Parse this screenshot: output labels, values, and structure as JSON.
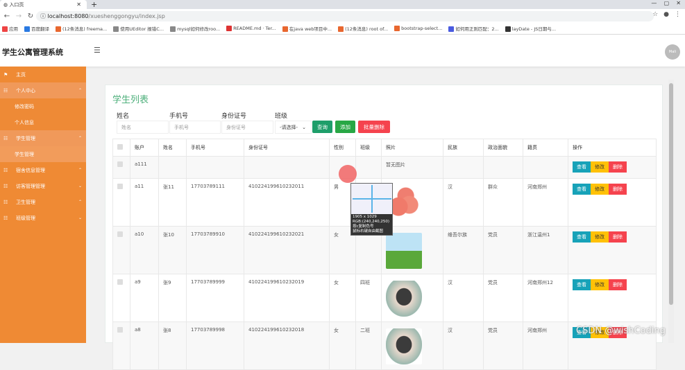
{
  "browser": {
    "tab_title": "入口页",
    "url_domain": "localhost:8080",
    "url_path": "/xueshenggongyu/index.jsp",
    "bookmarks": [
      "应用",
      "百度翻译",
      "(12条消息) freema...",
      "使用UEditor 报错C...",
      "mysql如何修改roo...",
      "README.md · Ter...",
      "在java web项目中...",
      "(12条消息) root of...",
      "bootstrap-select...",
      "如何用正则匹配：2...",
      "layDate - JS日期与..."
    ]
  },
  "header": {
    "title": "学生公寓管理系统",
    "avatar": "Mali"
  },
  "sidebar": {
    "items": [
      {
        "label": "主页",
        "icon": "flag-icon"
      },
      {
        "label": "个人中心",
        "icon": "grid-icon",
        "children": [
          "修改密码",
          "个人信息"
        ]
      },
      {
        "label": "学生管理",
        "icon": "grid-icon",
        "children": [
          "学生管理"
        ]
      },
      {
        "label": "宿舍信息管理",
        "icon": "grid-icon"
      },
      {
        "label": "访客管理管理",
        "icon": "grid-icon"
      },
      {
        "label": "卫生管理",
        "icon": "grid-icon"
      },
      {
        "label": "班级管理",
        "icon": "grid-icon"
      }
    ]
  },
  "main": {
    "title": "学生列表",
    "filters": {
      "name_label": "姓名",
      "name_placeholder": "姓名",
      "phone_label": "手机号",
      "phone_placeholder": "手机号",
      "id_label": "身份证号",
      "id_placeholder": "身份证号",
      "class_label": "班级",
      "class_value": "-请选择-"
    },
    "buttons": {
      "search": "查询",
      "add": "添加",
      "batch_delete": "批量删除"
    },
    "columns": [
      "账户",
      "姓名",
      "手机号",
      "身份证号",
      "性别",
      "班级",
      "照片",
      "民族",
      "政治面貌",
      "籍贯",
      "操作"
    ],
    "row_actions": {
      "view": "查看",
      "edit": "修改",
      "delete": "删除"
    },
    "rows": [
      {
        "account": "a111",
        "name": "",
        "phone": "",
        "idcard": "",
        "gender": "",
        "class": "",
        "photo": "暂无图片",
        "ethnic": "",
        "political": "",
        "native": ""
      },
      {
        "account": "a11",
        "name": "张11",
        "phone": "17703789111",
        "idcard": "410224199610232011",
        "gender": "男",
        "class": "",
        "photo": "",
        "ethnic": "汉",
        "political": "群众",
        "native": "河南郑州"
      },
      {
        "account": "a10",
        "name": "张10",
        "phone": "17703789910",
        "idcard": "410224199610232021",
        "gender": "女",
        "class": "",
        "photo": "",
        "ethnic": "维吾尔族",
        "political": "党员",
        "native": "浙江温州1"
      },
      {
        "account": "a9",
        "name": "张9",
        "phone": "17703789999",
        "idcard": "410224199610232019",
        "gender": "女",
        "class": "四班",
        "photo": "",
        "ethnic": "汉",
        "political": "党员",
        "native": "河南郑州12"
      },
      {
        "account": "a8",
        "name": "张8",
        "phone": "17703789998",
        "idcard": "410224199610232018",
        "gender": "女",
        "class": "二班",
        "photo": "",
        "ethnic": "汉",
        "political": "党员",
        "native": "河南郑州"
      }
    ]
  },
  "picker": {
    "size": "1905 x 1029",
    "rgb": "RGB:(240,240,250)",
    "hint1": "按c复制色号",
    "hint2": "鼠标右键自由截图"
  },
  "watermark": "CSDN @wishCoding",
  "colors": {
    "sidebar": "#ef8a34",
    "title": "#4caf7a",
    "search": "#1e9e6a",
    "add": "#28a745",
    "danger": "#f5434e",
    "info": "#17a2b8",
    "warning": "#ffc107"
  }
}
